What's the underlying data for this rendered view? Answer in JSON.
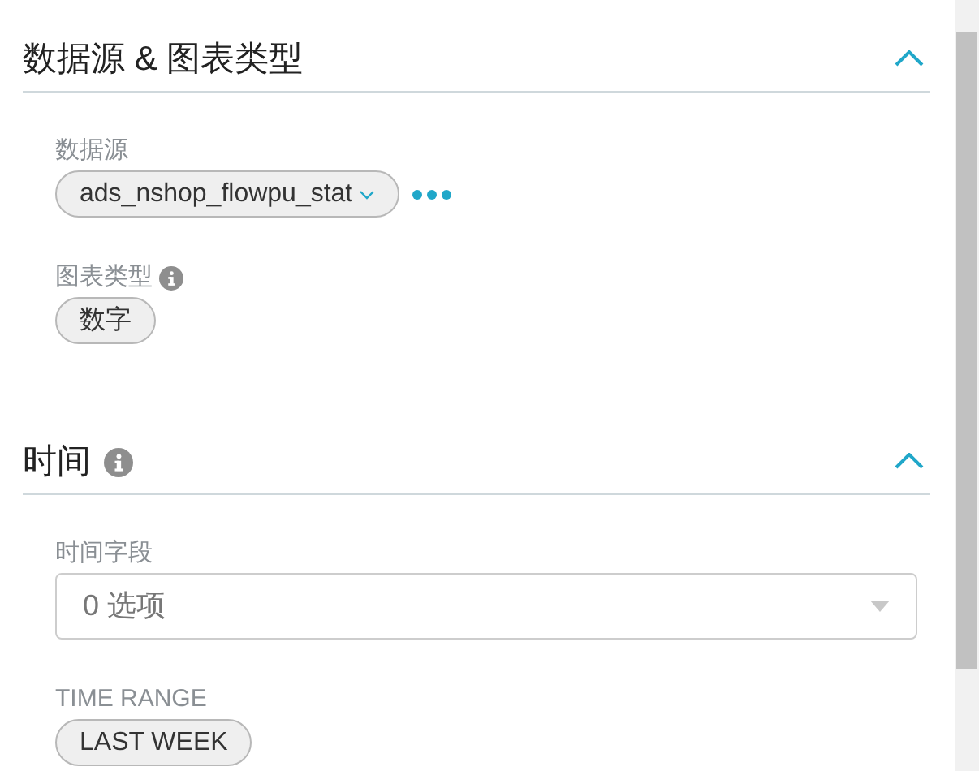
{
  "sections": [
    {
      "title": "数据源 & 图表类型",
      "info": false,
      "expanded": true,
      "fields": [
        {
          "kind": "pill-select",
          "label": "数据源",
          "info": false,
          "value": "ads_nshop_flowpu_stat",
          "more": true
        },
        {
          "kind": "pill",
          "label": "图表类型",
          "info": true,
          "value": "数字"
        }
      ]
    },
    {
      "title": "时间",
      "info": true,
      "expanded": true,
      "fields": [
        {
          "kind": "select",
          "label": "时间字段",
          "info": false,
          "placeholder": "0 选项"
        },
        {
          "kind": "pill",
          "label": "TIME RANGE",
          "info": false,
          "value": "LAST WEEK"
        }
      ]
    }
  ]
}
